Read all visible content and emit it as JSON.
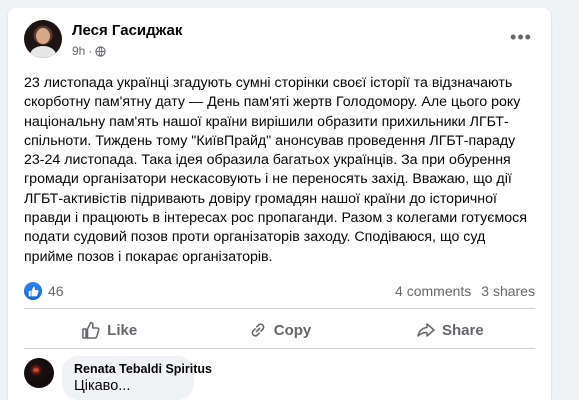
{
  "post": {
    "author": "Леся Гасиджак",
    "time": "9h",
    "privacy_icon": "globe-icon",
    "more_icon": "more-dots-icon",
    "more_label": "•••",
    "text": "23 листопада українці згадують сумні сторінки своєї історії та відзначають скорботну пам'ятну дату — День пам'яті жертв Голодомору. Але цього року національну пам'ять нашої країни вирішили образити прихильники ЛГБТ-спільноти. Тиждень тому \"КиївПрайд\" анонсував проведення ЛГБТ-параду 23-24 листопада. Така ідея образила багатьох українців. За при обурення громади організатори нескасовують і не переносять захід. Вважаю, що дії ЛГБТ-активістів підривають довіру громадян нашої країни до історичної правди і працюють в інтересах рос пропаганди. Разом з колегами готуємося подати судовий позов проти організаторів заходу. Сподіваюся, що суд прийме позов і покарає організаторів."
  },
  "stats": {
    "reaction_icon": "like-reaction-icon",
    "reactions": "46",
    "comments": "4 comments",
    "shares": "3 shares"
  },
  "actions": [
    {
      "label": "Like",
      "icon": "thumbs-up-icon"
    },
    {
      "label": "Copy",
      "icon": "copy-link-icon"
    },
    {
      "label": "Share",
      "icon": "share-arrow-icon"
    }
  ],
  "comment": {
    "author": "Renata Tebaldi Spiritus",
    "text": "Цікаво..."
  },
  "colors": {
    "accent": "#1877f2",
    "muted_text": "#65676b",
    "background": "#f0f2f5"
  }
}
